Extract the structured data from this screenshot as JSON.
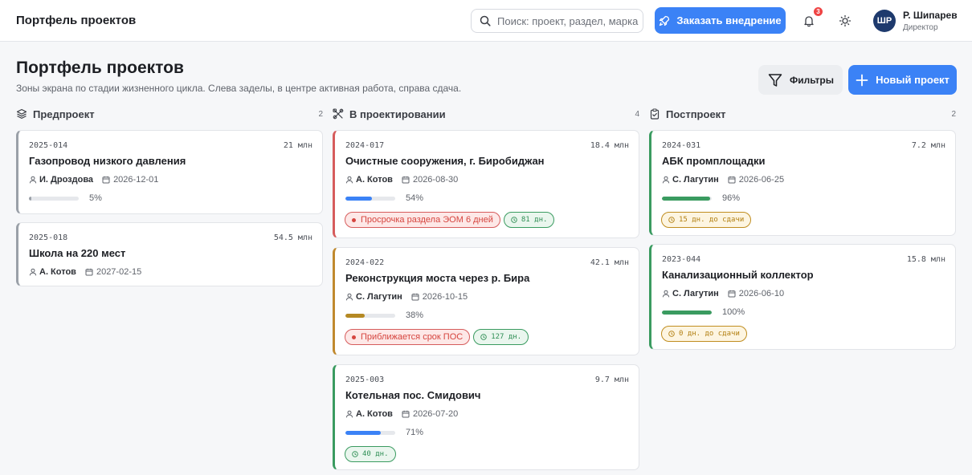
{
  "header": {
    "brand": "Портфель проектов",
    "search_placeholder": "Поиск: проект, раздел, марка",
    "order_label": "Заказать внедрение",
    "notifications_count": "3",
    "user": {
      "initials": "ШР",
      "name": "Р. Шипарев",
      "role": "Директор"
    }
  },
  "page": {
    "title": "Портфель проектов",
    "subtitle": "Зоны экрана по стадии жизненного цикла. Слева заделы, в центре активная работа, справа сдача.",
    "filters_label": "Фильтры",
    "new_project_label": "Новый проект"
  },
  "colors": {
    "accent": "#3b82f6",
    "gray": "#9aa0a8",
    "orange": "#c0892e",
    "red": "#d65c5c",
    "green": "#3a9b60"
  },
  "columns": [
    {
      "title": "Предпроект",
      "count": "2",
      "icon": "layers-icon",
      "cards": [
        {
          "code": "2025-014",
          "amount": "21 млн",
          "name": "Газопровод низкого давления",
          "person": "И. Дроздова",
          "date": "2026-12-01",
          "progress": 0.05,
          "pct": "5%",
          "tags": []
        },
        {
          "code": "2025-018",
          "amount": "54.5 млн",
          "name": "Школа на 220 мест",
          "person": "А. Котов",
          "date": "2027-02-15",
          "progress": null,
          "pct": "",
          "tags": []
        }
      ]
    },
    {
      "title": "В проектировании",
      "count": "4",
      "icon": "tools-icon",
      "cards": [
        {
          "code": "2024-017",
          "amount": "18.4 млн",
          "name": "Очистные сооружения, г. Биробиджан",
          "person": "А. Котов",
          "date": "2026-08-30",
          "progress": 0.54,
          "pct": "54%",
          "tags": [
            "Просрочка раздела ЭОМ 6 дней",
            "81 дн."
          ]
        },
        {
          "code": "2024-022",
          "amount": "42.1 млн",
          "name": "Реконструкция моста через р. Бира",
          "person": "С. Лагутин",
          "date": "2026-10-15",
          "progress": 0.38,
          "pct": "38%",
          "tags": [
            "Приближается срок ПОС",
            "127 дн."
          ]
        },
        {
          "code": "2025-003",
          "amount": "9.7 млн",
          "name": "Котельная пос. Смидович",
          "person": "А. Котов",
          "date": "2026-07-20",
          "progress": 0.71,
          "pct": "71%",
          "tags": [
            "40 дн."
          ]
        }
      ]
    },
    {
      "title": "Постпроект",
      "count": "2",
      "icon": "clipboard-check-icon",
      "cards": [
        {
          "code": "2024-031",
          "amount": "7.2 млн",
          "name": "АБК промплощадки",
          "person": "С. Лагутин",
          "date": "2026-06-25",
          "progress": 0.96,
          "pct": "96%",
          "tags": [
            "15 дн. до сдачи"
          ]
        },
        {
          "code": "2023-044",
          "amount": "15.8 млн",
          "name": "Канализационный коллектор",
          "person": "С. Лагутин",
          "date": "2026-06-10",
          "progress": 1.0,
          "pct": "100%",
          "tags": [
            "0 дн. до сдачи"
          ]
        }
      ]
    }
  ]
}
